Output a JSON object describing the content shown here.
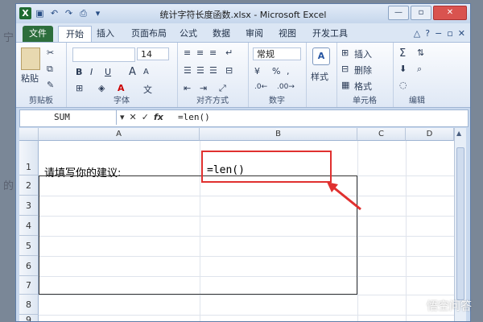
{
  "app": {
    "title": "统计字符长度函数.xlsx - Microsoft Excel",
    "window_controls": {
      "minimize": "—",
      "restore": "▫",
      "close": "✕"
    }
  },
  "background_text": {
    "left_top": "宁",
    "left_mid": "的"
  },
  "quick_access": [
    "save-icon",
    "undo-icon",
    "redo-icon",
    "print-icon"
  ],
  "tabs": [
    {
      "label": "文件"
    },
    {
      "label": "开始"
    },
    {
      "label": "插入"
    },
    {
      "label": "页面布局"
    },
    {
      "label": "公式"
    },
    {
      "label": "数据"
    },
    {
      "label": "审阅"
    },
    {
      "label": "视图"
    },
    {
      "label": "开发工具"
    }
  ],
  "ribbon": {
    "clipboard": {
      "label": "剪贴板",
      "paste": "粘贴"
    },
    "font": {
      "label": "字体",
      "size": "14",
      "bold": "B",
      "italic": "I",
      "underline": "U",
      "grow": "A",
      "shrink": "A"
    },
    "alignment": {
      "label": "对齐方式"
    },
    "number": {
      "label": "数字",
      "format": "常规",
      "percent": "%"
    },
    "styles": {
      "label": "样式"
    },
    "cells": {
      "label": "单元格",
      "insert": "插入",
      "delete": "删除",
      "format": "格式"
    },
    "editing": {
      "label": "编辑"
    }
  },
  "formula_bar": {
    "name_box": "SUM",
    "cancel": "✕",
    "enter": "✓",
    "fx": "fx",
    "value": "=len()"
  },
  "columns": [
    "A",
    "B",
    "C",
    "D"
  ],
  "rows": [
    "1",
    "2",
    "3",
    "4",
    "5",
    "6",
    "7",
    "8",
    "9"
  ],
  "cells": {
    "A1": "请填写你的建议:",
    "B1": "=len()"
  },
  "colors": {
    "annotation": "#e0302f",
    "file_tab": "#2d6e3c"
  },
  "watermark": "悟空问答"
}
